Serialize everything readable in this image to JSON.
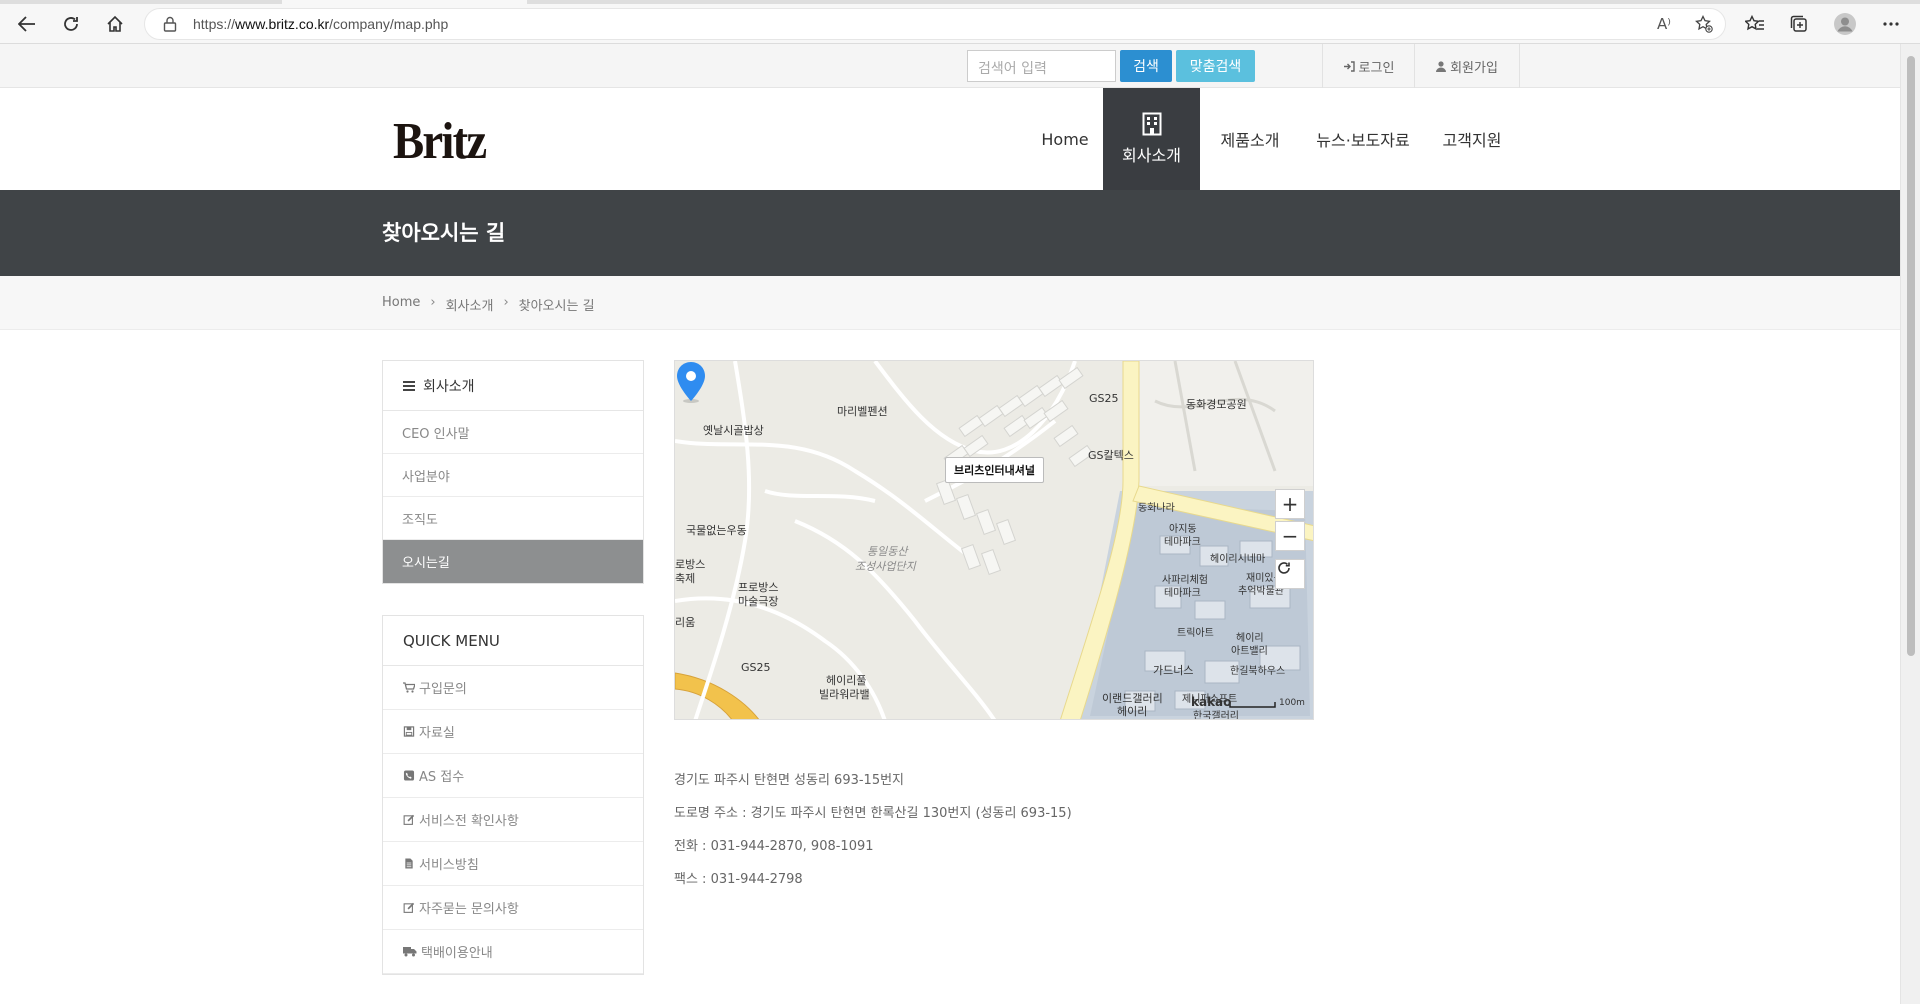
{
  "browser": {
    "url_prefix": "https://",
    "url_domain": "www.britz.co.kr",
    "url_path": "/company/map.php",
    "read_aloud_icon": "A⁾"
  },
  "topbar": {
    "search_placeholder": "검색어 입력",
    "search_button": "검색",
    "custom_search_button": "맞춤검색",
    "login": "로그인",
    "signup": "회원가입"
  },
  "header": {
    "logo": "Britz",
    "nav": [
      "Home",
      "회사소개",
      "제품소개",
      "뉴스·보도자료",
      "고객지원"
    ]
  },
  "page": {
    "title": "찾아오시는 길",
    "breadcrumb": [
      "Home",
      "회사소개",
      "찾아오시는 길"
    ]
  },
  "sidebar": {
    "title": "회사소개",
    "items": [
      "CEO 인사말",
      "사업분야",
      "조직도",
      "오시는길"
    ],
    "active_index": 3
  },
  "quick_menu": {
    "title": "QUICK MENU",
    "items": [
      {
        "icon": "cart-icon",
        "label": "구입문의"
      },
      {
        "icon": "save-icon",
        "label": "자료실"
      },
      {
        "icon": "phone-icon",
        "label": "AS 접수"
      },
      {
        "icon": "edit-icon",
        "label": "서비스전 확인사항"
      },
      {
        "icon": "file-icon",
        "label": "서비스방침"
      },
      {
        "icon": "edit-icon",
        "label": "자주묻는 문의사항"
      },
      {
        "icon": "truck-icon",
        "label": "택배이용안내"
      }
    ]
  },
  "map": {
    "marker_label": "브리츠인터내셔널",
    "scale_text": "100m",
    "brand": "kakao",
    "labels": [
      "마리벨펜션",
      "옛날시골밥상",
      "GS25",
      "동화경모공원",
      "GS칼텍스",
      "국물없는우동",
      "통일동산",
      "조성사업단지",
      "동화나라",
      "아지동",
      "테마파크",
      "헤이리시네마",
      "사파리체험",
      "테마파크",
      "재미있는",
      "추억박물관",
      "트릭아트",
      "헤이리",
      "아트밸리",
      "프로방스",
      "마술극장",
      "로방스",
      "축제",
      "리움",
      "GS25",
      "헤이리풀",
      "빌라워라밸",
      "가드너스",
      "한길북하우스",
      "이랜드갤러리",
      "헤이리",
      "제니퍼소프트",
      "한국갤러리"
    ]
  },
  "address": {
    "jibun": "경기도 파주시 탄현면 성동리 693-15번지",
    "road": "도로명 주소 : 경기도 파주시 탄현면 한록산길 130번지 (성동리 693-15)",
    "phone": "전화 : 031-944-2870, 908-1091",
    "fax": "팩스 : 031-944-2798"
  },
  "colors": {
    "nav_active_bg": "#3a3d41",
    "title_band": "#404447",
    "search_btn": "#2c8fd1",
    "custom_btn": "#5bc0de",
    "side_active": "#8d8f90",
    "map_pin": "#2f8cf0"
  }
}
